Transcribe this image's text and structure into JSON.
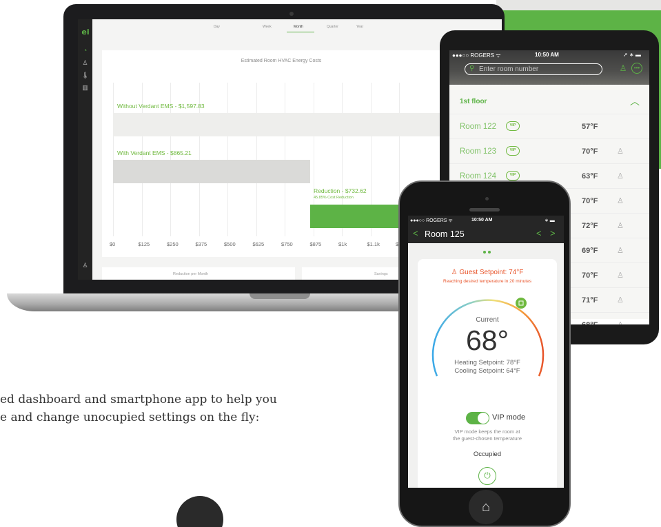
{
  "colors": {
    "accent": "#5db346",
    "warm": "#e8552b",
    "cool": "#3aa8e8",
    "dark": "#1c1c1e"
  },
  "laptop": {
    "logo": "ei",
    "sidebar_icons": [
      "chart-icon",
      "people-icon",
      "thermometer-icon",
      "building-icon",
      "user-icon"
    ],
    "tabs": [
      "Day",
      "Week",
      "Month",
      "Quarter",
      "Year"
    ],
    "active_tab": "Month",
    "bottom_cards": [
      "Reduction per Month",
      "Savings"
    ]
  },
  "chart_data": {
    "type": "bar",
    "title": "Estimated Room HVAC Energy Costs",
    "orientation": "horizontal",
    "x_ticks": [
      "$0",
      "$125",
      "$250",
      "$375",
      "$500",
      "$625",
      "$750",
      "$875",
      "$1k",
      "$1.1k",
      "$1"
    ],
    "series": [
      {
        "name": "Without Verdant EMS - $1,597.83",
        "value": 1597.83
      },
      {
        "name": "With Verdant EMS - $865.21",
        "value": 865.21
      },
      {
        "name": "Reduction - $732.62",
        "value": 732.62,
        "note": "45.85% Cost Reduction"
      }
    ]
  },
  "tablet": {
    "status_carrier": "●●●○○ ROGERS ᯤ",
    "status_time": "10:50 AM",
    "search_placeholder": "Enter room number",
    "floor": "1st floor",
    "rooms": [
      {
        "name": "Room 122",
        "vip": "VIP",
        "temp": "57°F"
      },
      {
        "name": "Room 123",
        "vip": "VIP",
        "temp": "70°F"
      },
      {
        "name": "Room 124",
        "vip": "VIP",
        "temp": "63°F"
      },
      {
        "name": "",
        "vip": "",
        "temp": "70°F"
      },
      {
        "name": "",
        "vip": "",
        "temp": "72°F"
      },
      {
        "name": "",
        "vip": "",
        "temp": "69°F"
      },
      {
        "name": "",
        "vip": "",
        "temp": "70°F"
      },
      {
        "name": "",
        "vip": "",
        "temp": "71°F"
      },
      {
        "name": "",
        "vip": "",
        "temp": "68°F"
      }
    ]
  },
  "phone": {
    "status_carrier": "●●●○○ ROGERS ᯤ",
    "status_time": "10:50 AM",
    "room_title": "Room 125",
    "guest_setpoint": "Guest Setpoint: 74°F",
    "reaching_text": "Reaching desired temperature in 20 minutes",
    "current_label": "Current",
    "current_temp": "68°",
    "heating_setpoint": "Heating Setpoint: 78°F",
    "cooling_setpoint": "Cooling Setpoint: 64°F",
    "vip_mode_label": "VIP mode",
    "vip_mode_desc_1": "VIP mode keeps the room at",
    "vip_mode_desc_2": "the guest-chosen temperature",
    "occupancy": "Occupied",
    "vip_mode_on": true
  },
  "caption": {
    "line1": "ed dashboard and smartphone app to help you",
    "line2": "e and change unocupied settings on the fly:"
  }
}
